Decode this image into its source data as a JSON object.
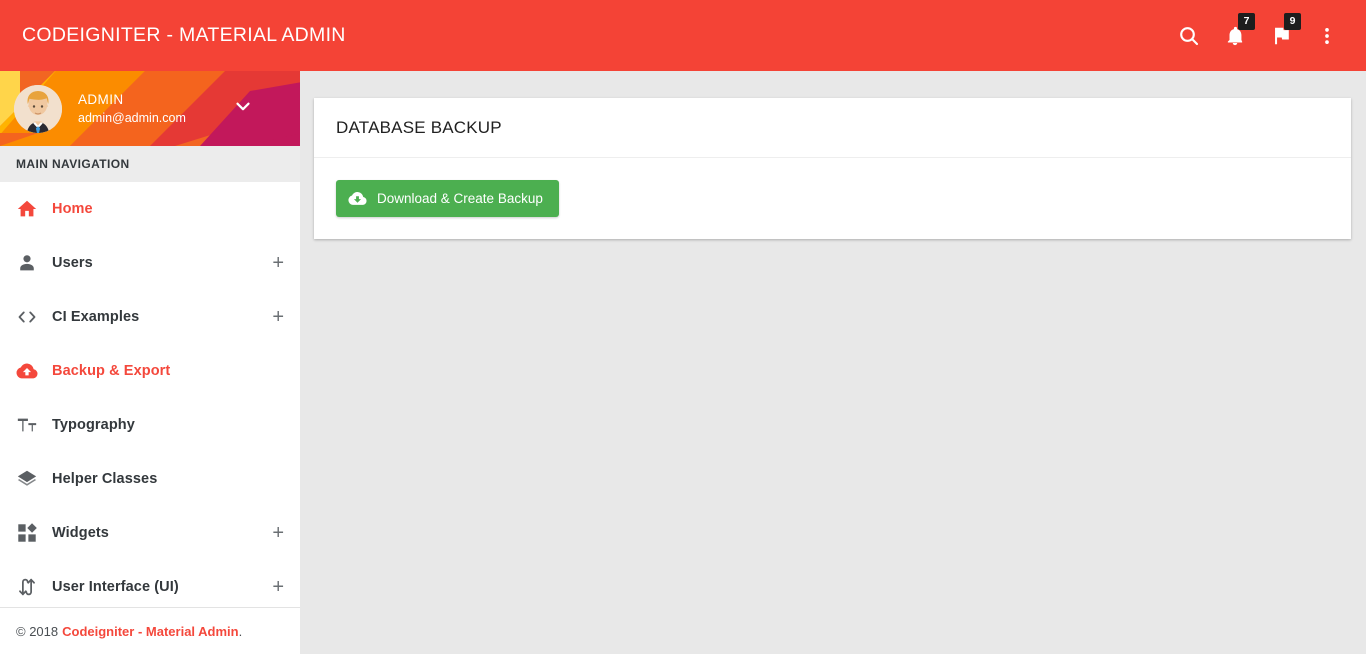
{
  "topbar": {
    "brand": "CODEIGNITER - MATERIAL ADMIN",
    "accent_color": "#f44336",
    "actions": [
      {
        "name": "search-icon",
        "label": "Search",
        "badge": null
      },
      {
        "name": "bell-icon",
        "label": "Notifications",
        "badge": "7"
      },
      {
        "name": "flag-icon",
        "label": "Tasks",
        "badge": "9"
      },
      {
        "name": "dots-vertical-icon",
        "label": "More",
        "badge": null
      }
    ]
  },
  "sidebar": {
    "user": {
      "name": "ADMIN",
      "email": "admin@admin.com",
      "caret": "chevron-down-icon"
    },
    "nav_header": "MAIN NAVIGATION",
    "items": [
      {
        "icon": "home-icon",
        "label": "Home",
        "active": true,
        "expandable": false,
        "expand_label": "+"
      },
      {
        "icon": "person-icon",
        "label": "Users",
        "active": false,
        "expandable": true,
        "expand_label": "+"
      },
      {
        "icon": "code-icon",
        "label": "CI Examples",
        "active": false,
        "expandable": true,
        "expand_label": "+"
      },
      {
        "icon": "cloud-upload-icon",
        "label": "Backup & Export",
        "active": true,
        "expandable": false,
        "expand_label": "+"
      },
      {
        "icon": "text-format-icon",
        "label": "Typography",
        "active": false,
        "expandable": false,
        "expand_label": "+"
      },
      {
        "icon": "layers-icon",
        "label": "Helper Classes",
        "active": false,
        "expandable": false,
        "expand_label": "+"
      },
      {
        "icon": "dashboard-icon",
        "label": "Widgets",
        "active": false,
        "expandable": true,
        "expand_label": "+"
      },
      {
        "icon": "swap-vert-icon",
        "label": "User Interface (UI)",
        "active": false,
        "expandable": true,
        "expand_label": "+"
      }
    ],
    "footer": {
      "copyright": "© 2018",
      "link": "Codeigniter - Material Admin",
      "suffix": "."
    },
    "accent_color": "#f4483c"
  },
  "main": {
    "card": {
      "title": "DATABASE BACKUP",
      "button": {
        "label": "Download & Create Backup",
        "icon": "cloud-download-icon",
        "color": "#4caf50"
      }
    },
    "background_color": "#e8e8e8"
  }
}
